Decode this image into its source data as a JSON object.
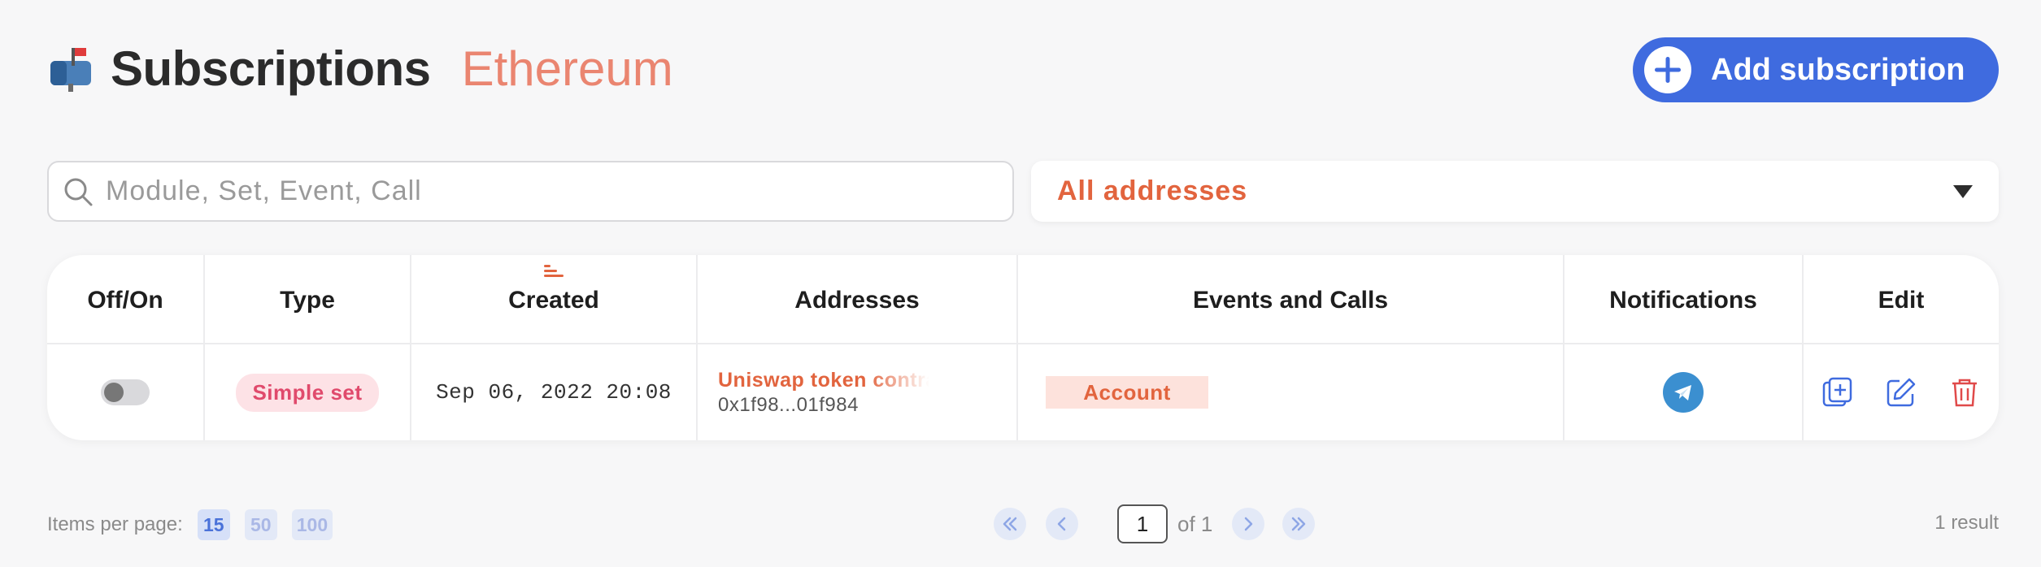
{
  "header": {
    "title": "Subscriptions",
    "network": "Ethereum",
    "add_button_label": "Add subscription",
    "icon": "mailbox-icon"
  },
  "filters": {
    "search_placeholder": "Module, Set, Event, Call",
    "search_value": "",
    "address_filter": "All addresses"
  },
  "table": {
    "columns": [
      "Off/On",
      "Type",
      "Created",
      "Addresses",
      "Events and Calls",
      "Notifications",
      "Edit"
    ],
    "sorted_column": "Created",
    "rows": [
      {
        "enabled": false,
        "type": "Simple set",
        "created": "Sep 06, 2022 20:08",
        "address_name": "Uniswap token contract",
        "address_hash": "0x1f98...01f984",
        "events": [
          "Account"
        ],
        "notification": "telegram-icon"
      }
    ]
  },
  "footer": {
    "items_per_page_label": "Items per page:",
    "page_sizes": [
      "15",
      "50",
      "100"
    ],
    "selected_page_size": "15",
    "current_page": "1",
    "of_label": "of 1",
    "result_count": "1 result"
  },
  "colors": {
    "accent": "#e2643e",
    "primary": "#3f6bdf",
    "badge_bg": "#fde2e6",
    "badge_text": "#e04a6c",
    "telegram": "#3b8fd0",
    "delete": "#e04a4a"
  }
}
